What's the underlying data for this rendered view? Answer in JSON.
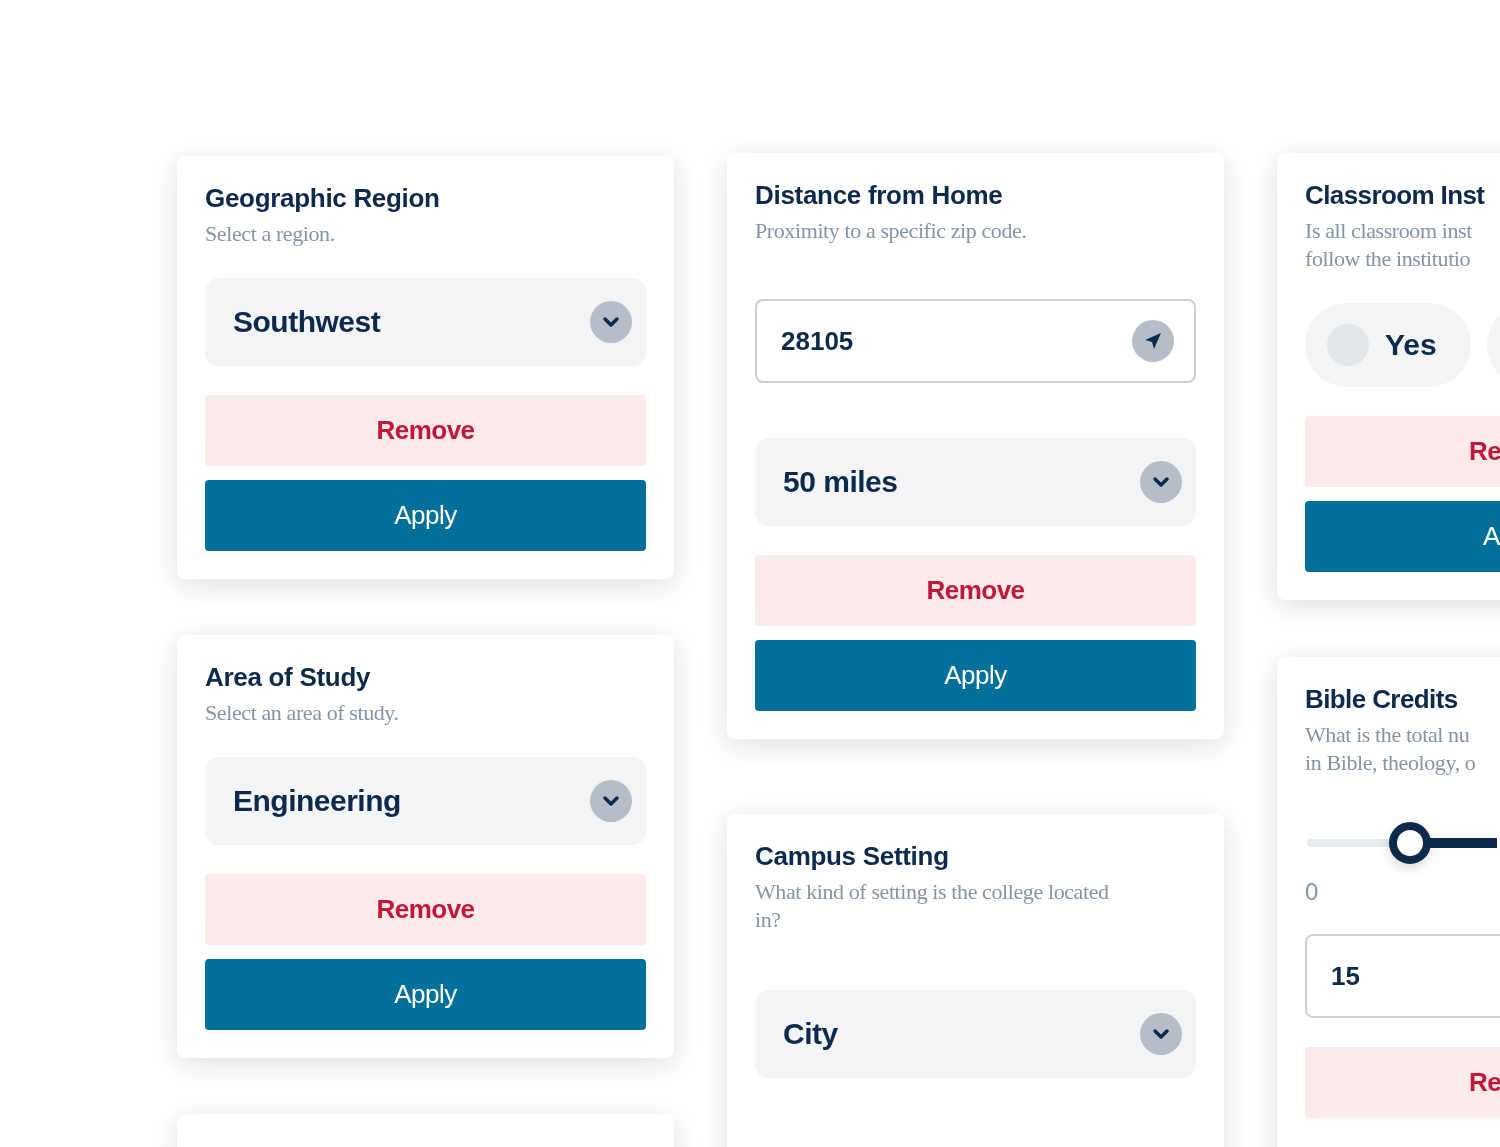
{
  "columns": [
    {
      "cards": [
        {
          "kind": "select",
          "title": "Geographic Region",
          "description": [
            "Select a region."
          ],
          "value": "Southwest",
          "remove": "Remove",
          "apply": "Apply"
        },
        {
          "kind": "select",
          "title": "Area of Study",
          "description": [
            "Select an area of study."
          ],
          "value": "Engineering",
          "remove": "Remove",
          "apply": "Apply"
        },
        {
          "kind": "blank"
        }
      ]
    },
    {
      "cards": [
        {
          "kind": "distance",
          "title": "Distance from Home",
          "description": [
            "Proximity to a specific zip code."
          ],
          "zip": "28105",
          "value": "50 miles",
          "remove": "Remove",
          "apply": "Apply"
        },
        {
          "kind": "select",
          "title": "Campus Setting",
          "description": [
            "What kind of setting is the college located",
            "in?"
          ],
          "value": "City"
        }
      ]
    },
    {
      "cards": [
        {
          "kind": "radio",
          "title": "Classroom Inst",
          "description": [
            "Is all classroom inst",
            "follow the institutio"
          ],
          "options": [
            {
              "label": "Yes",
              "selected": false
            }
          ],
          "remove": "Re",
          "apply": "A"
        },
        {
          "kind": "range",
          "title": "Bible Credits",
          "description": [
            "What is the total nu",
            "in Bible, theology, o"
          ],
          "slider": {
            "level": 0.54
          },
          "min_label": "0",
          "value": "15",
          "remove": "Re"
        }
      ]
    }
  ]
}
